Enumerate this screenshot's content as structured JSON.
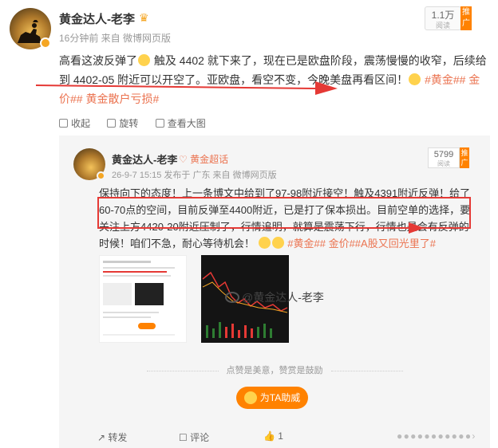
{
  "author": {
    "name": "黄金达人-老李",
    "meta": "16分钟前  来自 微博网页版"
  },
  "views": {
    "count": "1.1万",
    "label": "阅读"
  },
  "promote_label": "推广",
  "post": {
    "text_a": "高看这波反弹了",
    "text_b": " 触及 4402 就下来了，现在已是欧盘阶段，震荡慢慢的收窄，后续给到 4402-05 附近可以开空了。亚欧盘，看空不变，今晚美盘再看区间！",
    "topics": "#黄金## 金价## 黄金散户亏损#"
  },
  "actions": {
    "collect": "收起",
    "rotate": "旋转",
    "view_large": "查看大图"
  },
  "repost": {
    "name": "黄金达人-老李",
    "tag": "黄金超话",
    "meta": "26-9-7 15:15  发布于 广东  来自 微博网页版",
    "views": {
      "count": "5799",
      "label": "阅读"
    },
    "text": "保持向下的态度！上一条博文中给到了97-98附近接空！触及4391附近反弹！给了60-70点的空间，目前反弹至4400附近，已是打了保本损出。目前空单的选择，要关注上方4420-20附近压制了，行情追明，就算是震荡下行，行情也是会有反弹的时候！咱们不急，耐心等待机会！",
    "topics": "#黄金## 金价##A股又回光里了#",
    "watermark": "@黄金达人-老李",
    "like_note": "点赞是美意，赞赏是鼓励",
    "support_button": "为TA助威",
    "share": "转发",
    "comment": "评论",
    "like_count": "1"
  },
  "colors": {
    "accent": "#ff8200",
    "topic": "#eb7350",
    "annotation": "#e53935"
  }
}
